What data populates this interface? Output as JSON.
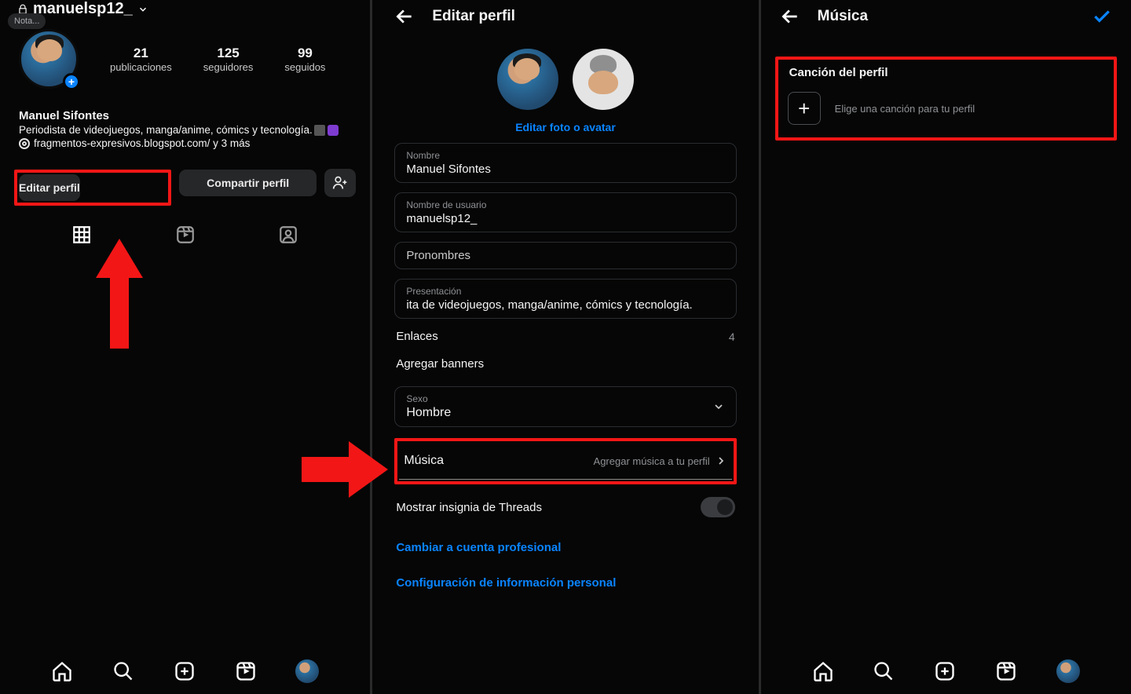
{
  "panel1": {
    "username": "manuelsp12_",
    "note": "Nota...",
    "stats": {
      "posts_n": "21",
      "posts_l": "publicaciones",
      "followers_n": "125",
      "followers_l": "seguidores",
      "following_n": "99",
      "following_l": "seguidos"
    },
    "display_name": "Manuel Sifontes",
    "bio": "Periodista de videojuegos, manga/anime, cómics y tecnología.",
    "link_text": "fragmentos-expresivos.blogspot.com/ y 3 más",
    "btn_edit": "Editar perfil",
    "btn_share": "Compartir perfil"
  },
  "panel2": {
    "title": "Editar perfil",
    "edit_photo": "Editar foto o avatar",
    "name_lbl": "Nombre",
    "name_val": "Manuel Sifontes",
    "user_lbl": "Nombre de usuario",
    "user_val": "manuelsp12_",
    "pron_lbl": "Pronombres",
    "pres_lbl": "Presentación",
    "pres_val": "ita de videojuegos, manga/anime, cómics y tecnología.",
    "links_lbl": "Enlaces",
    "links_cnt": "4",
    "banners_lbl": "Agregar banners",
    "sex_lbl": "Sexo",
    "sex_val": "Hombre",
    "music_lbl": "Música",
    "music_hint": "Agregar música a tu perfil",
    "threads_lbl": "Mostrar insignia de Threads",
    "switch_pro": "Cambiar a cuenta profesional",
    "personal_cfg": "Configuración de información personal"
  },
  "panel3": {
    "title": "Música",
    "section": "Canción del perfil",
    "hint": "Elige una canción para tu perfil"
  }
}
